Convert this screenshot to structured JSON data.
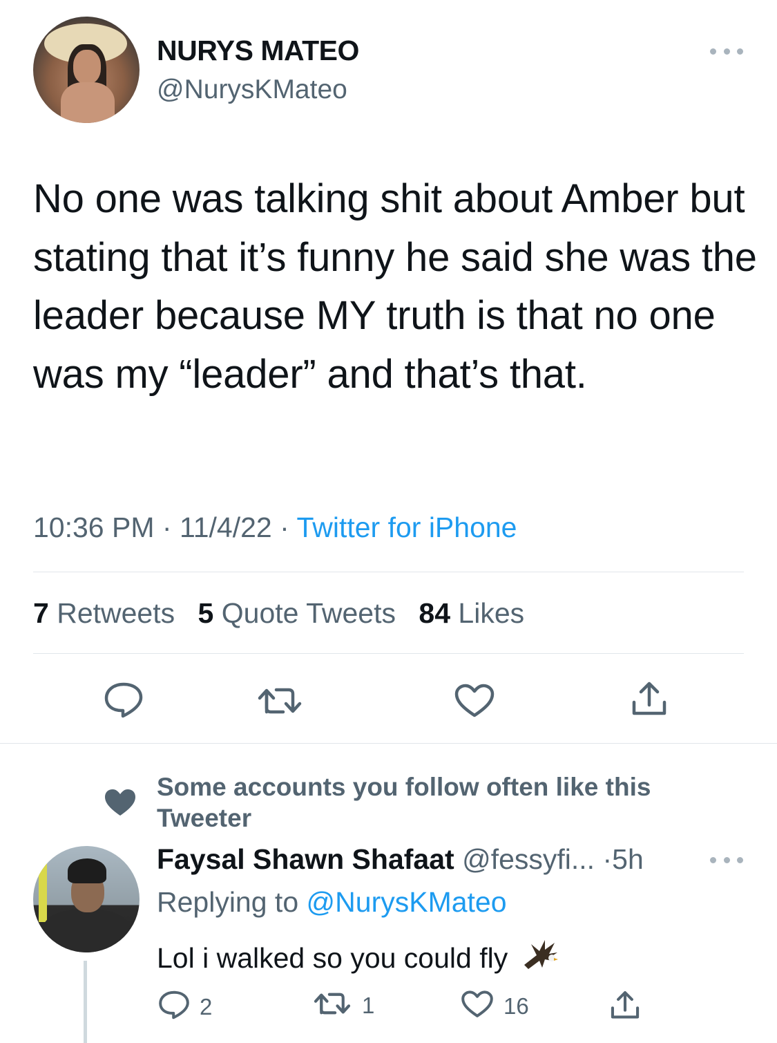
{
  "tweet": {
    "display_name": "NURYS MATEO",
    "handle": "@NurysKMateo",
    "text": "No one was talking shit about Amber but stating that it’s funny he said she was the leader because MY truth is that no one was my “leader” and that’s that.",
    "time": "10:36 PM",
    "date": "11/4/22",
    "separator": "·",
    "source": "Twitter for iPhone",
    "stats": {
      "retweets_count": "7",
      "retweets_label": "Retweets",
      "quotes_count": "5",
      "quotes_label": "Quote Tweets",
      "likes_count": "84",
      "likes_label": "Likes"
    },
    "actions": [
      "reply-icon",
      "retweet-icon",
      "like-icon",
      "share-icon"
    ]
  },
  "context": {
    "icon": "heart-icon",
    "text": "Some accounts you follow often like this Tweeter"
  },
  "reply": {
    "display_name": "Faysal Shawn Shafaat",
    "handle": "@fessyfi...",
    "separator": "·",
    "age": "5h",
    "replying_prefix": "Replying to",
    "replying_mention": "@NurysKMateo",
    "text": "Lol i walked so you could fly",
    "emoji": "eagle-icon",
    "reply_count": "2",
    "retweet_count": "1",
    "like_count": "16"
  },
  "colors": {
    "text": "#0f1419",
    "secondary": "#536471",
    "link": "#1d9bf0",
    "divider": "#e1e6ea"
  }
}
